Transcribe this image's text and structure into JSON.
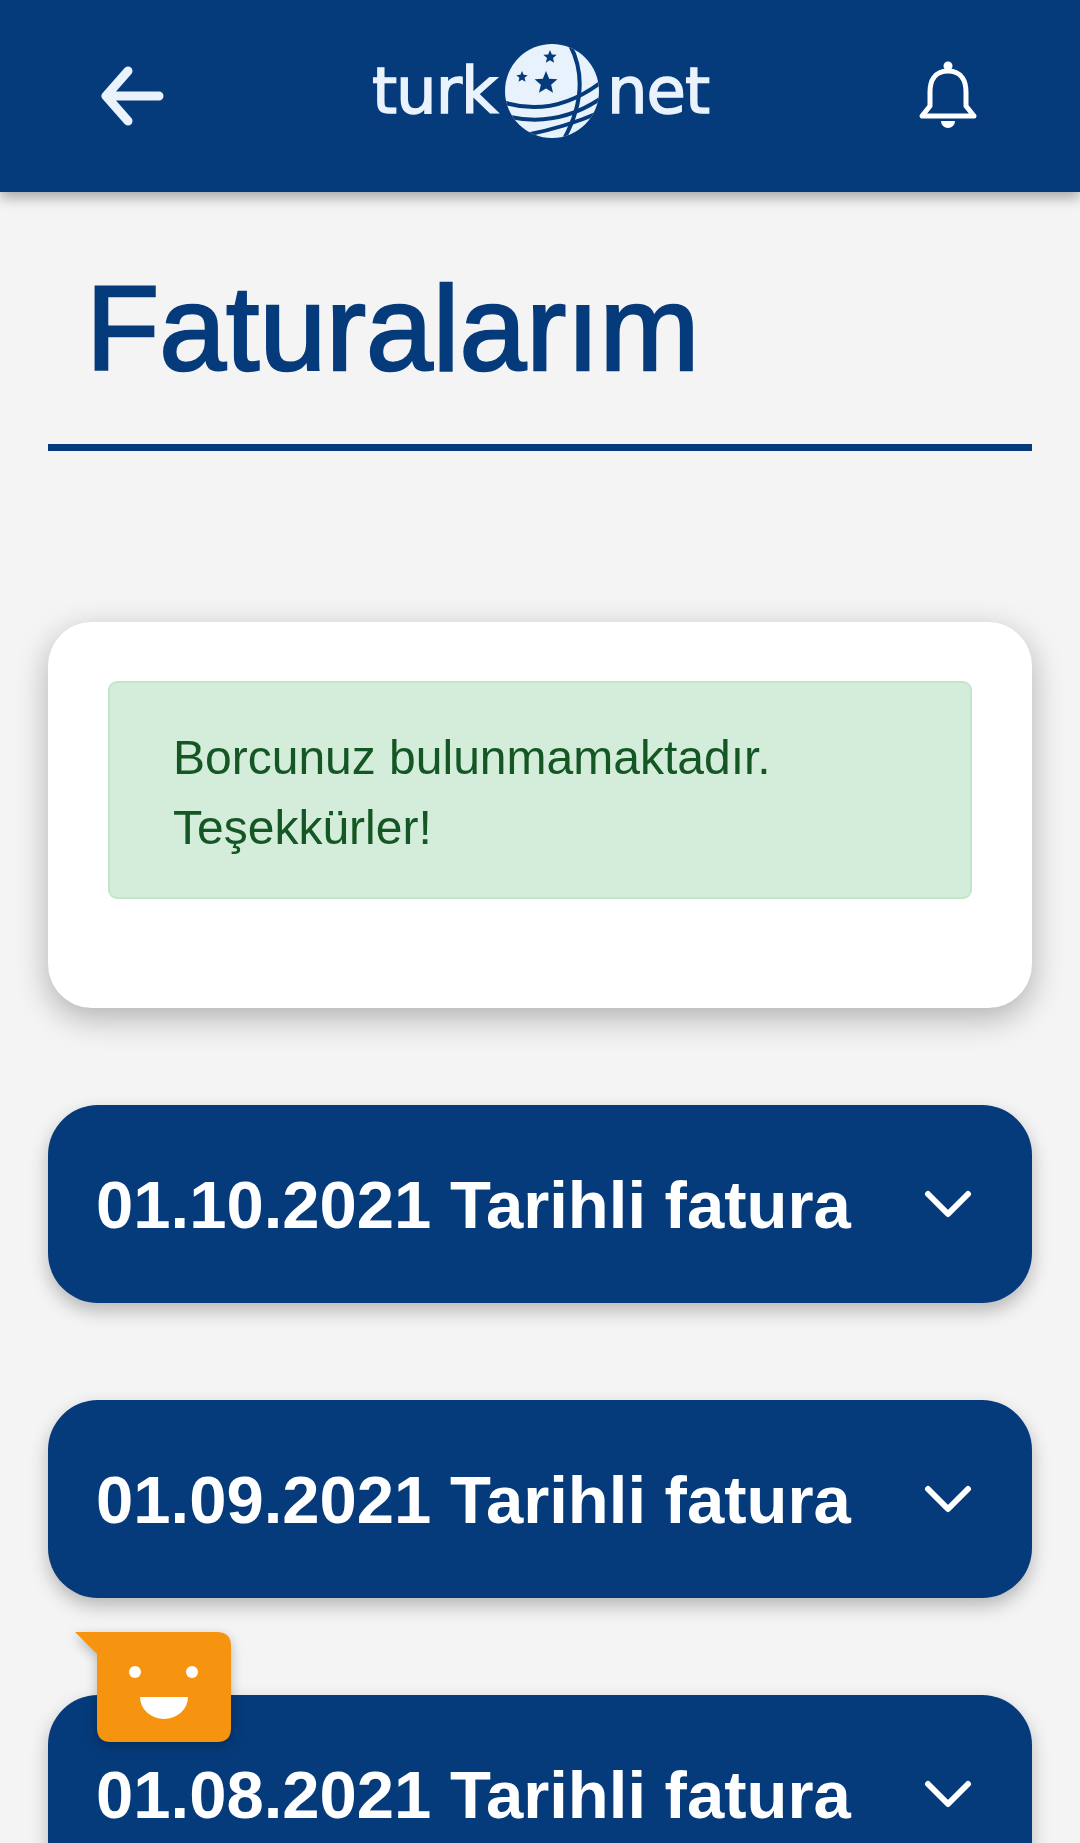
{
  "header": {
    "logo": {
      "left_text": "turk",
      "right_text": "net"
    }
  },
  "page_title": "Faturalarım",
  "balance_card": {
    "alert": {
      "kind": "success",
      "text": "Borcunuz bulunmamaktadır. Teşekkürler!"
    }
  },
  "invoices": [
    {
      "label": "01.10.2021 Tarihli fatura",
      "expanded": false
    },
    {
      "label": "01.09.2021 Tarihli fatura",
      "expanded": false
    },
    {
      "label": "01.08.2021 Tarihli fatura",
      "expanded": false
    }
  ]
}
